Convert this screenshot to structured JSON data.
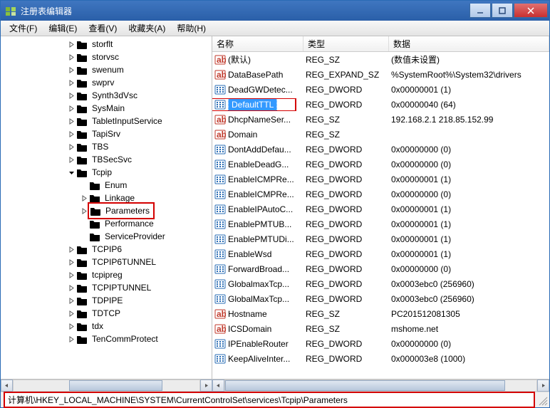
{
  "window": {
    "title": "注册表编辑器"
  },
  "menu": {
    "file": "文件(F)",
    "edit": "编辑(E)",
    "view": "查看(V)",
    "favorites": "收藏夹(A)",
    "help": "帮助(H)"
  },
  "tree": {
    "items": [
      {
        "label": "storflt",
        "depth": 0
      },
      {
        "label": "storvsc",
        "depth": 0
      },
      {
        "label": "swenum",
        "depth": 0
      },
      {
        "label": "swprv",
        "depth": 0
      },
      {
        "label": "Synth3dVsc",
        "depth": 0
      },
      {
        "label": "SysMain",
        "depth": 0
      },
      {
        "label": "TabletInputService",
        "depth": 0
      },
      {
        "label": "TapiSrv",
        "depth": 0
      },
      {
        "label": "TBS",
        "depth": 0
      },
      {
        "label": "TBSecSvc",
        "depth": 0
      },
      {
        "label": "Tcpip",
        "depth": 0,
        "expanded": true
      },
      {
        "label": "Enum",
        "depth": 1,
        "leaf": true
      },
      {
        "label": "Linkage",
        "depth": 1
      },
      {
        "label": "Parameters",
        "depth": 1,
        "highlight": true
      },
      {
        "label": "Performance",
        "depth": 1,
        "leaf": true
      },
      {
        "label": "ServiceProvider",
        "depth": 1,
        "leaf": true
      },
      {
        "label": "TCPIP6",
        "depth": 0
      },
      {
        "label": "TCPIP6TUNNEL",
        "depth": 0
      },
      {
        "label": "tcpipreg",
        "depth": 0
      },
      {
        "label": "TCPIPTUNNEL",
        "depth": 0
      },
      {
        "label": "TDPIPE",
        "depth": 0
      },
      {
        "label": "TDTCP",
        "depth": 0
      },
      {
        "label": "tdx",
        "depth": 0
      },
      {
        "label": "TenCommProtect",
        "depth": 0
      }
    ]
  },
  "columns": {
    "name": "名称",
    "type": "类型",
    "data": "数据"
  },
  "rows": [
    {
      "icon": "ab",
      "name": "(默认)",
      "type": "REG_SZ",
      "data": "(数值未设置)"
    },
    {
      "icon": "ab",
      "name": "DataBasePath",
      "type": "REG_EXPAND_SZ",
      "data": "%SystemRoot%\\System32\\drivers"
    },
    {
      "icon": "bin",
      "name": "DeadGWDetec...",
      "type": "REG_DWORD",
      "data": "0x00000001 (1)"
    },
    {
      "icon": "bin",
      "name": "DefaultTTL",
      "type": "REG_DWORD",
      "data": "0x00000040 (64)",
      "selected": true,
      "highlight": true
    },
    {
      "icon": "ab",
      "name": "DhcpNameSer...",
      "type": "REG_SZ",
      "data": "192.168.2.1 218.85.152.99"
    },
    {
      "icon": "ab",
      "name": "Domain",
      "type": "REG_SZ",
      "data": ""
    },
    {
      "icon": "bin",
      "name": "DontAddDefau...",
      "type": "REG_DWORD",
      "data": "0x00000000 (0)"
    },
    {
      "icon": "bin",
      "name": "EnableDeadG...",
      "type": "REG_DWORD",
      "data": "0x00000000 (0)"
    },
    {
      "icon": "bin",
      "name": "EnableICMPRe...",
      "type": "REG_DWORD",
      "data": "0x00000001 (1)"
    },
    {
      "icon": "bin",
      "name": "EnableICMPRe...",
      "type": "REG_DWORD",
      "data": "0x00000000 (0)"
    },
    {
      "icon": "bin",
      "name": "EnableIPAutoC...",
      "type": "REG_DWORD",
      "data": "0x00000001 (1)"
    },
    {
      "icon": "bin",
      "name": "EnablePMTUB...",
      "type": "REG_DWORD",
      "data": "0x00000001 (1)"
    },
    {
      "icon": "bin",
      "name": "EnablePMTUDi...",
      "type": "REG_DWORD",
      "data": "0x00000001 (1)"
    },
    {
      "icon": "bin",
      "name": "EnableWsd",
      "type": "REG_DWORD",
      "data": "0x00000001 (1)"
    },
    {
      "icon": "bin",
      "name": "ForwardBroad...",
      "type": "REG_DWORD",
      "data": "0x00000000 (0)"
    },
    {
      "icon": "bin",
      "name": "GlobalmaxTcp...",
      "type": "REG_DWORD",
      "data": "0x0003ebc0 (256960)"
    },
    {
      "icon": "bin",
      "name": "GlobalMaxTcp...",
      "type": "REG_DWORD",
      "data": "0x0003ebc0 (256960)"
    },
    {
      "icon": "ab",
      "name": "Hostname",
      "type": "REG_SZ",
      "data": "PC201512081305"
    },
    {
      "icon": "ab",
      "name": "ICSDomain",
      "type": "REG_SZ",
      "data": "mshome.net"
    },
    {
      "icon": "bin",
      "name": "IPEnableRouter",
      "type": "REG_DWORD",
      "data": "0x00000000 (0)"
    },
    {
      "icon": "bin",
      "name": "KeepAliveInter...",
      "type": "REG_DWORD",
      "data": "0x000003e8 (1000)"
    }
  ],
  "status": {
    "path": "计算机\\HKEY_LOCAL_MACHINE\\SYSTEM\\CurrentControlSet\\services\\Tcpip\\Parameters"
  }
}
